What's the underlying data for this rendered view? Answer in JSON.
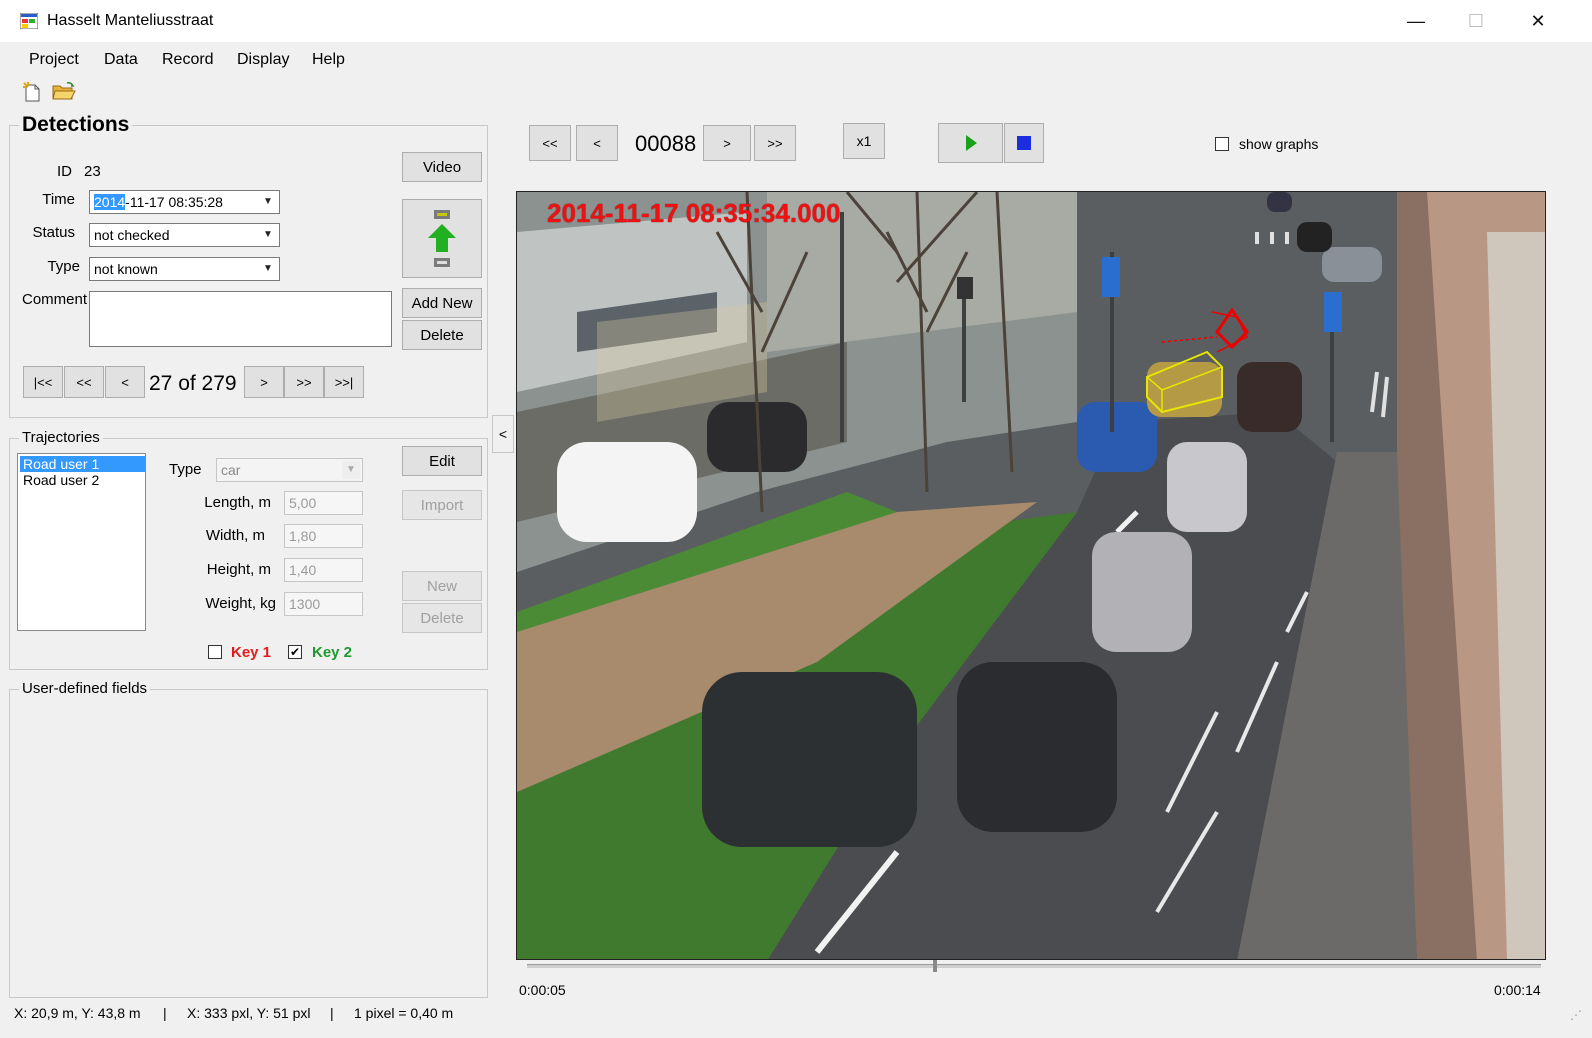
{
  "window": {
    "title": "Hasselt Manteliusstraat",
    "min": "—",
    "max": "☐",
    "close": "✕"
  },
  "menu": [
    "Project",
    "Data",
    "Record",
    "Display",
    "Help"
  ],
  "detections": {
    "title": "Detections",
    "id_label": "ID",
    "id_value": "23",
    "time_label": "Time",
    "time_sel": "2014",
    "time_rest": "-11-17  08:35:28",
    "status_label": "Status",
    "status_value": "not checked",
    "type_label": "Type",
    "type_value": "not known",
    "comment_label": "Comment",
    "video_btn": "Video",
    "add_new_btn": "Add New",
    "delete_btn": "Delete",
    "nav": {
      "first": "|<<",
      "prev_fast": "<<",
      "prev": "<",
      "counter": "27 of 279",
      "next": ">",
      "next_fast": ">>",
      "last": ">>|"
    }
  },
  "trajectories": {
    "title": "Trajectories",
    "items": [
      "Road user 1",
      "Road user 2"
    ],
    "type_label": "Type",
    "type_value": "car",
    "length_label": "Length, m",
    "length_value": "5,00",
    "width_label": "Width, m",
    "width_value": "1,80",
    "height_label": "Height, m",
    "height_value": "1,40",
    "weight_label": "Weight, kg",
    "weight_value": "1300",
    "edit_btn": "Edit",
    "import_btn": "Import",
    "new_btn": "New",
    "delete_btn": "Delete",
    "key1": "Key 1",
    "key2": "Key 2",
    "key1_color": "#e31b1b",
    "key2_color": "#1f9a2e"
  },
  "user_fields": {
    "title": "User-defined fields"
  },
  "collapse_arrow": "<",
  "player": {
    "prev_fast": "<<",
    "prev": "<",
    "frame": "00088",
    "next": ">",
    "next_fast": ">>",
    "speed": "x1",
    "show_graphs": "show graphs",
    "timestamp": "2014-11-17  08:35:34.000",
    "time_start": "0:00:05",
    "time_end": "0:00:14",
    "progress": 0.4
  },
  "status": {
    "world": "X: 20,9 m, Y: 43,8 m",
    "pixel": "X: 333 pxl, Y: 51 pxl",
    "scale": "1 pixel = 0,40 m",
    "sep": "|"
  },
  "colors": {
    "selection": "#3399ff",
    "play": "#1aa01a",
    "stop": "#1a2ee0",
    "timestamp": "#e11111"
  }
}
